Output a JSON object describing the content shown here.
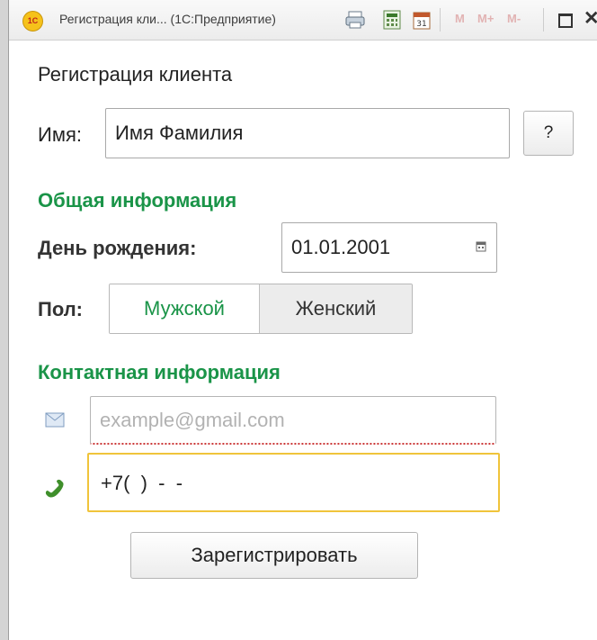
{
  "window": {
    "logo_text": "1С",
    "title": "Регистрация кли... (1С:Предприятие)",
    "memory_buttons": [
      "M",
      "M+",
      "M-"
    ],
    "icons": [
      "print-icon",
      "calculator-icon",
      "calendar-icon",
      "maximize-icon",
      "close-icon"
    ]
  },
  "form": {
    "title": "Регистрация клиента",
    "name_label": "Имя:",
    "name_value": "Имя Фамилия",
    "help_label": "?",
    "general_group": "Общая информация",
    "birthday_label": "День рождения:",
    "birthday_value": "01.01.2001",
    "sex_label": "Пол:",
    "sex_options": [
      "Мужской",
      "Женский"
    ],
    "sex_selected": "Мужской",
    "contact_group": "Контактная информация",
    "email_placeholder": "example@gmail.com",
    "email_value": "",
    "phone_value": "+7(  )  -  -",
    "register_label": "Зарегистрировать"
  },
  "colors": {
    "accent_green": "#1a9448",
    "focus_yellow": "#f0c43b",
    "error_red": "#cc3a3a"
  }
}
